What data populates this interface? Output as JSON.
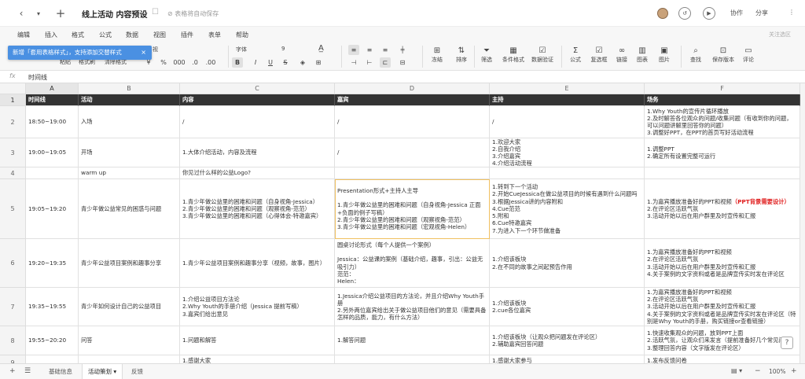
{
  "header": {
    "title": "线上活动 内容预设",
    "autosave": "表格将自动保存",
    "collab": "协作",
    "share": "分享",
    "more": "⋮"
  },
  "menu": [
    "编辑",
    "插入",
    "格式",
    "公式",
    "数据",
    "视图",
    "插件",
    "表单",
    "帮助"
  ],
  "menu_right": "关注选区",
  "toast": {
    "text": "新增「套用表格样式」，支持添加交替样式",
    "close": "×"
  },
  "toolbar": {
    "left_labels": [
      "粘贴",
      "格式刷",
      "清除格式"
    ],
    "hidden_label": "视",
    "font": "字体",
    "font_size": "9",
    "bold": "B",
    "italic": "I",
    "underline": "U",
    "strike": "S",
    "currency": "¥",
    "percent": "%",
    "thousands": "000",
    "dec1": ".0",
    "dec2": ".00",
    "tools": [
      "冻结",
      "排序",
      "筛选",
      "条件格式",
      "数据验证",
      "公式",
      "复选框",
      "链接",
      "图表",
      "图片",
      "查找",
      "保存版本",
      "评论"
    ]
  },
  "formula": {
    "fx": "fx",
    "value": "时间线"
  },
  "columns": [
    "A",
    "B",
    "C",
    "D",
    "E",
    "F"
  ],
  "rows": [
    {
      "num": "1",
      "a": "时间线",
      "b": "活动",
      "c": "内容",
      "d": "嘉宾",
      "e": "主持",
      "f": "场务"
    },
    {
      "num": "2",
      "a": "18:50~19:00",
      "b": "入场",
      "c": "/",
      "d": "/",
      "e": "/",
      "f": "1.Why Youth的宣传片循环播放\n2.及时解答各位观众的问题/收集问题（有收到你的问题，可以问题讲解里回答你的问题）\n3.调整好PPT，在PPT的首页写好活动流程"
    },
    {
      "num": "3",
      "a": "19:00~19:05",
      "b": "开场",
      "c": "1.大体介绍活动，内容及流程",
      "d": "/",
      "e": "1.欢迎大家\n2.自我介绍\n3.介绍嘉宾\n4.介绍活动流程",
      "f": "1.调整PPT\n2.确定所有设置完整可运行"
    },
    {
      "num": "4",
      "a": "",
      "b": "warm up",
      "c": "你见过什么样的公益Logo?",
      "d": "",
      "e": "",
      "f": ""
    },
    {
      "num": "5",
      "a": "19:05~19:20",
      "b": "青少年做公益常见的困惑与问题",
      "c": "1.青少年做公益里的困难和问题（自身视角-Jessica）\n2.青少年做公益里的困难和问题（观察视角-范范）\n3.青少年做公益里的困难和问题（心得体会-特邀嘉宾）",
      "d": "Presentation形式+主持人主导\n\n1.青少年做公益里的困难和问题（自身视角-Jessica 正面+负面的例子写稿）\n2.青少年做公益里的困难和问题（观察视角-范范）\n3.青少年做公益里的困难和问题（宏观视角-Helen）",
      "e": "1.转到下一个活动\n2.开始CueJessica在做公益项目的时候有遇到什么问题吗\n3.根据Jessica讲的内容附和\n4.Cue范范\n5.附和\n6.Cue特邀嘉宾\n7.为进入下一个环节做准备",
      "f": "1.为嘉宾播放准备好的PPT和视频",
      "f_red": "（PPT背景需要设计）",
      "f2": "\n2.在评论区活跃气氛\n3.活动开始以后在用户群里及时宣传和汇报"
    },
    {
      "num": "6",
      "a": "19:20~19:35",
      "b": "青少年公益项目案例和趣事分享",
      "c": "1.青少年公益项目案例和趣事分享（视频，故事，图片）",
      "d": "圆桌讨论形式（每个人提供一个案例）\n\nJessica：公益课的案例（基础介绍，趣事，引出：公益无吸引力）\n范范：\nHelen：",
      "e": "1.介绍该板块\n2.在不同的故事之间起预告作用",
      "f": "1.为嘉宾播放准备好的PPT和视频\n2.在评论区活跃气氛\n3.活动开始以后在用户群里及时宣传和汇报\n4.关于案例的文字资料或者是品牌宣传实时发在评论区"
    },
    {
      "num": "7",
      "a": "19:35~19:55",
      "b": "青少年如何设计自己的公益项目",
      "c": "1.介绍公益项目方法论\n2.Why Youth的手册介绍（Jessica 提前写稿）\n3.嘉宾们给出意见",
      "d": "1.Jessica介绍公益项目的方法论，并且介绍Why Youth手册\n2.另外两位嘉宾给出关于做公益项目他们的意见（需要具备怎样的品质，能力，有什么方法）",
      "e": "1.介绍该板块\n2.cue各位嘉宾",
      "f": "1.为嘉宾播放准备好的PPT和视频\n2.在评论区活跃气氛\n3.活动开始以后在用户群里及时宣传和汇报\n4.关于案例的文字资料或者是品牌宣传实时发在评论区（特别是Why Youth的手册，购买链接or查看链接）"
    },
    {
      "num": "8",
      "a": "19:55~20:20",
      "b": "问答",
      "c": "1.问题和解答",
      "d": "1.解答问题",
      "e": "1.介绍该板块（让观众把问题发在评论区）\n2.辅助嘉宾回答问题",
      "f": "1.快速收集观众的问题，放到PPT上面\n2.活跃气氛，让观众们来发言（提前准备好几个常见问题）\n3.整理回答内容（文字版发在评论区）"
    },
    {
      "num": "9",
      "a": "",
      "b": "",
      "c": "1.感谢大家",
      "d": "",
      "e": "1.感谢大家参与",
      "f": "1.发布反馈问卷"
    }
  ],
  "sheets": [
    "基础信息",
    "活动策划",
    "反馈"
  ],
  "zoom": "100%",
  "help": "?"
}
